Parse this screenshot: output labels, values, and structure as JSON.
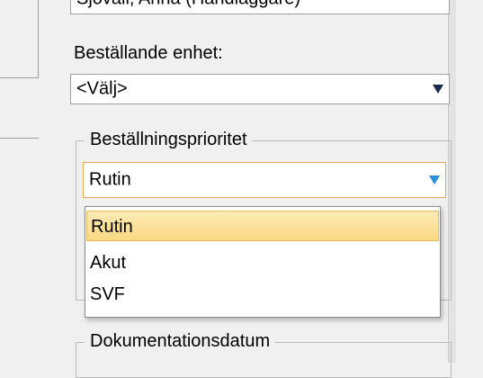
{
  "handlaggare_combo": {
    "value": "Sjövall, Anna (Handläggare)"
  },
  "bestallande_enhet": {
    "label": "Beställande enhet:",
    "value": "<Välj>"
  },
  "prioritet_group": {
    "title": "Beställningsprioritet",
    "selected": "Rutin",
    "options": [
      "Rutin",
      "Akut",
      "SVF"
    ]
  },
  "dokumentation_group": {
    "title": "Dokumentationsdatum"
  }
}
